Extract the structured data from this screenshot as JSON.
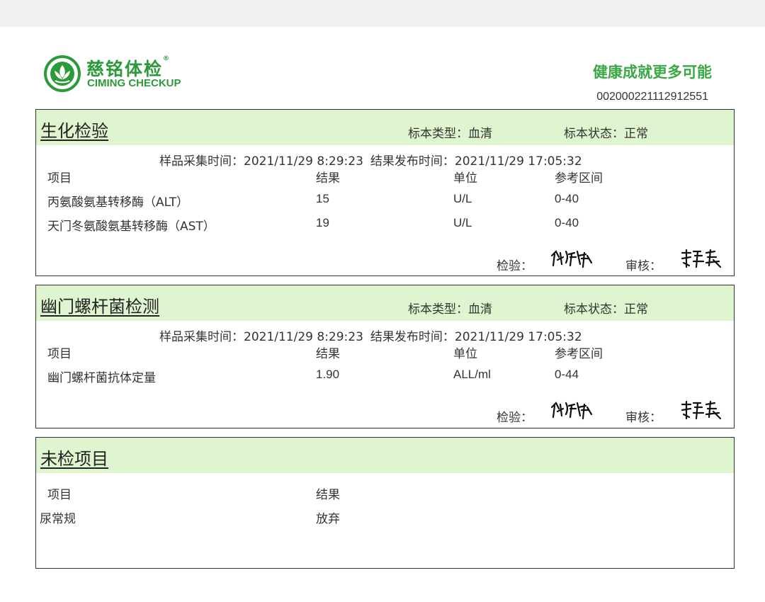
{
  "header": {
    "brand_cn": "慈铭体检",
    "brand_en": "CIMING CHECKUP",
    "slogan": "健康成就更多可能",
    "report_no": "00200022111291255​1"
  },
  "sections": [
    {
      "title": "生化检验",
      "sample_type": "标本类型：血清",
      "sample_state": "标本状态：正常",
      "collect_time": "样品采集时间：2021/11/29 8:29:23",
      "release_time": "结果发布时间：2021/11/29 17:05:32",
      "columns": [
        "项目",
        "结果",
        "单位",
        "参考区间"
      ],
      "rows": [
        {
          "item": "丙氨酸氨基转移酶（ALT）",
          "result": "15",
          "unit": "U/L",
          "ref": "0-40"
        },
        {
          "item": "天门冬氨酸氨基转移酶（AST）",
          "result": "19",
          "unit": "U/L",
          "ref": "0-40"
        }
      ],
      "inspector_label": "检验：",
      "reviewer_label": "审核："
    },
    {
      "title": "幽门螺杆菌检测",
      "sample_type": "标本类型：血清",
      "sample_state": "标本状态：正常",
      "collect_time": "样品采集时间：2021/11/29 8:29:23",
      "release_time": "结果发布时间：2021/11/29 17:05:32",
      "columns": [
        "项目",
        "结果",
        "单位",
        "参考区间"
      ],
      "rows": [
        {
          "item": "幽门螺杆菌抗体定量",
          "result": "1.90",
          "unit": "ALL/ml",
          "ref": "0-44"
        }
      ],
      "inspector_label": "检验：",
      "reviewer_label": "审核："
    },
    {
      "title": "未检项目",
      "columns": [
        "项目",
        "结果"
      ],
      "rows": [
        {
          "item": "尿常规",
          "result": "放弃"
        }
      ]
    }
  ],
  "colors": {
    "brand_green": "#2c9a3a",
    "header_fill": "#dff5cf"
  }
}
